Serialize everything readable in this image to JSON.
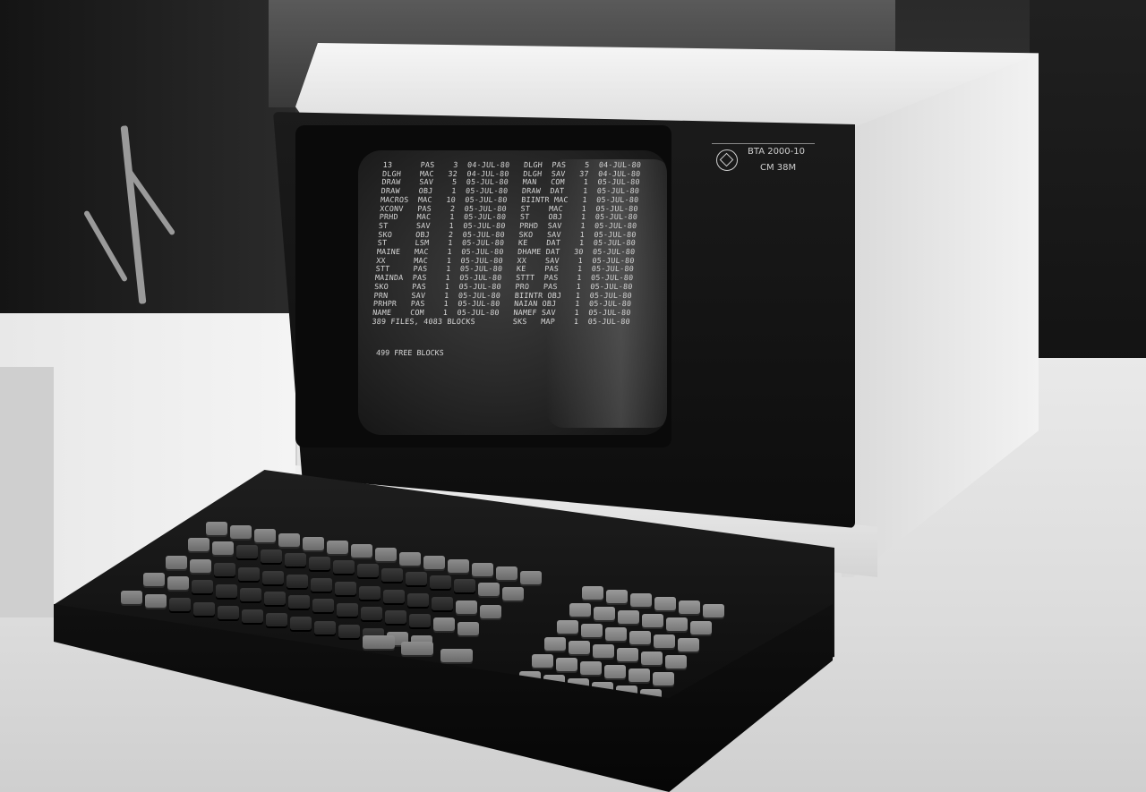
{
  "monitor": {
    "badge_model": "BTA 2000-10",
    "badge_sub": "CM 38M",
    "screen_lines": [
      "13      PAS    3  04-JUL-80   DLGH  PAS    5  04-JUL-80",
      "DLGH    MAC   32  04-JUL-80   DLGH  SAV   37  04-JUL-80",
      "DRAW    SAV    5  05-JUL-80   MAN   COM    1  05-JUL-80",
      "DRAW    OBJ    1  05-JUL-80   DRAW  DAT    1  05-JUL-80",
      "MACROS  MAC   10  05-JUL-80   BIINTR MAC   1  05-JUL-80",
      "XCONV   PAS    2  05-JUL-80   ST    MAC    1  05-JUL-80",
      "PRHD    MAC    1  05-JUL-80   ST    OBJ    1  05-JUL-80",
      "ST      SAV    1  05-JUL-80   PRHD  SAV    1  05-JUL-80",
      "SKO     OBJ    2  05-JUL-80   SKO   SAV    1  05-JUL-80",
      "ST      LSM    1  05-JUL-80   KE    DAT    1  05-JUL-80",
      "MAINE   MAC    1  05-JUL-80   DHAME DAT   30  05-JUL-80",
      "XX      MAC    1  05-JUL-80   XX    SAV    1  05-JUL-80",
      "STT     PAS    1  05-JUL-80   KE    PAS    1  05-JUL-80",
      "MAINDA  PAS    1  05-JUL-80   STTT  PAS    1  05-JUL-80",
      "SKO     PAS    1  05-JUL-80   PRO   PAS    1  05-JUL-80",
      "PRN     SAV    1  05-JUL-80   BIINTR OBJ   1  05-JUL-80",
      "PRHPR   PAS    1  05-JUL-80   NAIAN OBJ    1  05-JUL-80",
      "NAME    COM    1  05-JUL-80   NAMEF SAV    1  05-JUL-80",
      "389 FILES, 4083 BLOCKS        SKS   MAP    1  05-JUL-80"
    ],
    "screen_footer": "499 FREE BLOCKS"
  }
}
